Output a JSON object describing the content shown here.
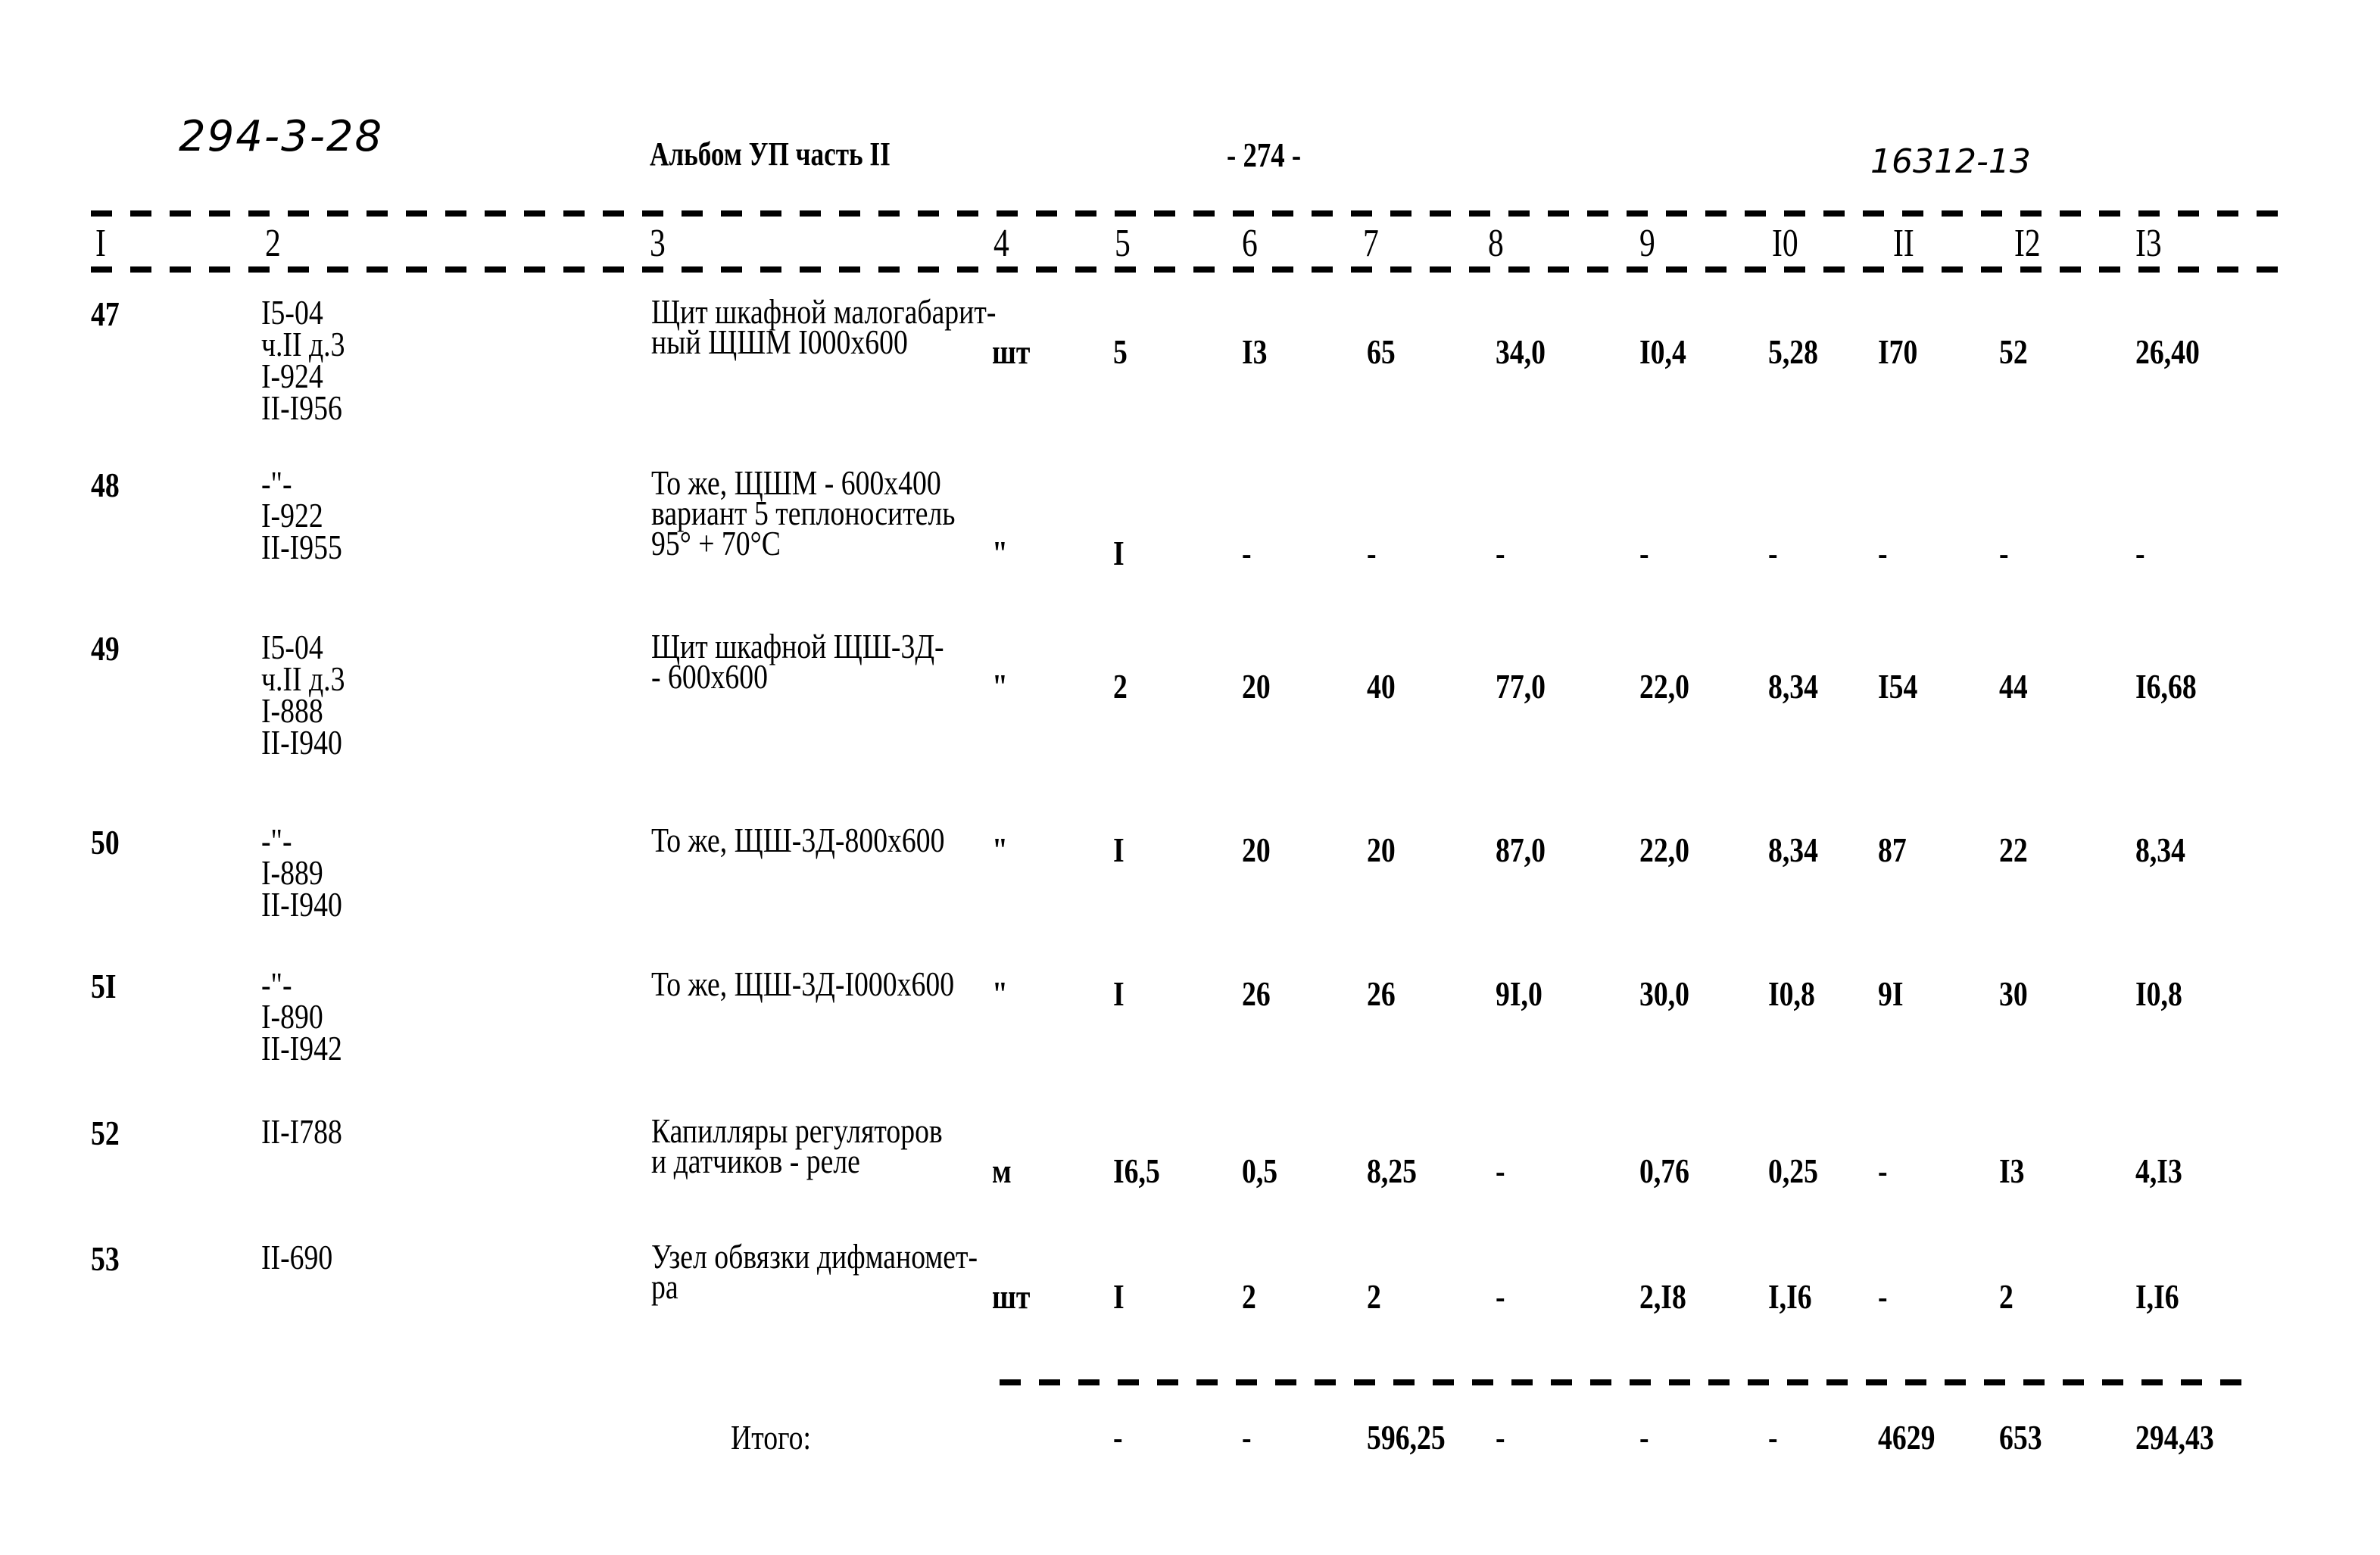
{
  "header": {
    "doc_code": "294-3-28",
    "album": "Альбом УП часть II",
    "page_number": "- 274 -",
    "stamp": "16312-13"
  },
  "columns": [
    "I",
    "2",
    "3",
    "4",
    "5",
    "6",
    "7",
    "8",
    "9",
    "I0",
    "II",
    "I2",
    "I3"
  ],
  "rows": [
    {
      "num": "47",
      "ref": [
        "I5-04",
        "ч.II д.3",
        "I-924",
        "II-I956"
      ],
      "desc": [
        "Щит шкафной малогабарит-",
        "ный ЩШМ I000x600"
      ],
      "unit": "шт",
      "values": [
        "5",
        "I3",
        "65",
        "34,0",
        "I0,4",
        "5,28",
        "I70",
        "52",
        "26,40"
      ]
    },
    {
      "num": "48",
      "ref": [
        "-\"-",
        "I-922",
        "II-I955"
      ],
      "desc": [
        "То же, ЩШМ - 600x400",
        "вариант 5 теплоноситель",
        "95° + 70°С"
      ],
      "unit": "\"",
      "values": [
        "I",
        "-",
        "-",
        "-",
        "-",
        "-",
        "-",
        "-",
        "-"
      ]
    },
    {
      "num": "49",
      "ref": [
        "I5-04",
        "ч.II д.3",
        "I-888",
        "II-I940"
      ],
      "desc": [
        "Щит шкафной ЩШ-3Д-",
        "- 600x600"
      ],
      "unit": "\"",
      "values": [
        "2",
        "20",
        "40",
        "77,0",
        "22,0",
        "8,34",
        "I54",
        "44",
        "I6,68"
      ]
    },
    {
      "num": "50",
      "ref": [
        "-\"-",
        "I-889",
        "II-I940"
      ],
      "desc": [
        "То же, ЩШ-3Д-800x600"
      ],
      "unit": "\"",
      "values": [
        "I",
        "20",
        "20",
        "87,0",
        "22,0",
        "8,34",
        "87",
        "22",
        "8,34"
      ]
    },
    {
      "num": "5I",
      "ref": [
        "-\"-",
        "I-890",
        "II-I942"
      ],
      "desc": [
        "То же, ЩШ-3Д-I000x600"
      ],
      "unit": "\"",
      "values": [
        "I",
        "26",
        "26",
        "9I,0",
        "30,0",
        "I0,8",
        "9I",
        "30",
        "I0,8"
      ]
    },
    {
      "num": "52",
      "ref": [
        "II-I788"
      ],
      "desc": [
        "Капилляры регуляторов",
        "и датчиков - реле"
      ],
      "unit": "м",
      "values": [
        "I6,5",
        "0,5",
        "8,25",
        "-",
        "0,76",
        "0,25",
        "-",
        "I3",
        "4,I3"
      ]
    },
    {
      "num": "53",
      "ref": [
        "II-690"
      ],
      "desc": [
        "Узел обвязки дифманомет-",
        "ра"
      ],
      "unit": "шт",
      "values": [
        "I",
        "2",
        "2",
        "-",
        "2,I8",
        "I,I6",
        "-",
        "2",
        "I,I6"
      ]
    }
  ],
  "total": {
    "label": "Итого:",
    "values": [
      "-",
      "-",
      "596,25",
      "-",
      "-",
      "-",
      "4629",
      "653",
      "294,43"
    ]
  }
}
